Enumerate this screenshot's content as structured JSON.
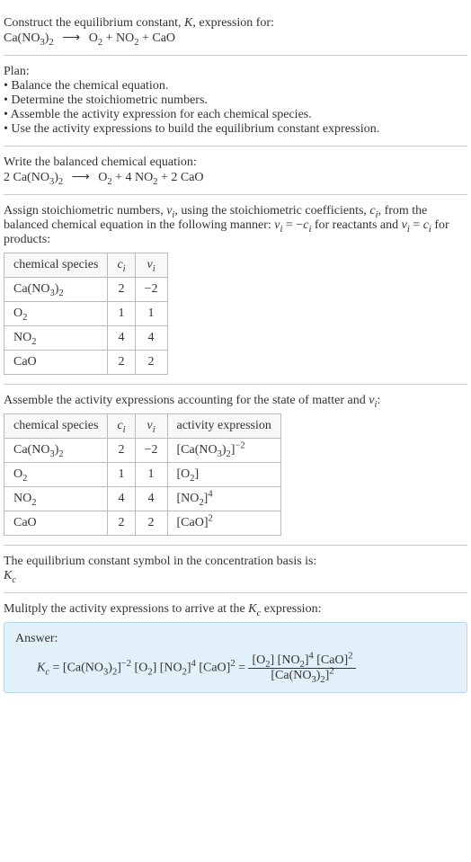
{
  "intro": {
    "line1_pre": "Construct the equilibrium constant, ",
    "line1_k": "K",
    "line1_post": ", expression for:"
  },
  "eq_unbalanced": {
    "r1": "Ca(NO",
    "r1s": "3",
    "r1_close": ")",
    "r1s2": "2",
    "p1": "O",
    "p1s": "2",
    "p2": "NO",
    "p2s": "2",
    "p3": "CaO"
  },
  "plan": {
    "header": "Plan:",
    "b1": "Balance the chemical equation.",
    "b2": "Determine the stoichiometric numbers.",
    "b3": "Assemble the activity expression for each chemical species.",
    "b4": "Use the activity expressions to build the equilibrium constant expression."
  },
  "balanced": {
    "header": "Write the balanced chemical equation:",
    "c1": "2 Ca(NO",
    "c1s": "3",
    "c1_close": ")",
    "c1s2": "2",
    "c2": "O",
    "c2s": "2",
    "c3": "4 NO",
    "c3s": "2",
    "c4": "2 CaO"
  },
  "stoich": {
    "text1": "Assign stoichiometric numbers, ",
    "nu": "ν",
    "nus": "i",
    "text2": ", using the stoichiometric coefficients, ",
    "c": "c",
    "cs": "i",
    "text3": ", from the balanced chemical equation in the following manner: ",
    "rel1_l": "ν",
    "rel1_ls": "i",
    "rel1_eq": " = −",
    "rel1_r": "c",
    "rel1_rs": "i",
    "text4": " for reactants and ",
    "rel2_l": "ν",
    "rel2_ls": "i",
    "rel2_eq": " = ",
    "rel2_r": "c",
    "rel2_rs": "i",
    "text5": " for products:"
  },
  "table1": {
    "h1": "chemical species",
    "h2c": "c",
    "h2s": "i",
    "h3c": "ν",
    "h3s": "i",
    "r1a": "Ca(NO",
    "r1as1": "3",
    "r1ac": ")",
    "r1as2": "2",
    "r1b": "2",
    "r1c": "−2",
    "r2a": "O",
    "r2as": "2",
    "r2b": "1",
    "r2c": "1",
    "r3a": "NO",
    "r3as": "2",
    "r3b": "4",
    "r3c": "4",
    "r4a": "CaO",
    "r4b": "2",
    "r4c": "2"
  },
  "activity": {
    "text1": "Assemble the activity expressions accounting for the state of matter and ",
    "nu": "ν",
    "nus": "i",
    "colon": ":"
  },
  "table2": {
    "h1": "chemical species",
    "h2c": "c",
    "h2s": "i",
    "h3c": "ν",
    "h3s": "i",
    "h4": "activity expression",
    "r1a": "Ca(NO",
    "r1as1": "3",
    "r1ac": ")",
    "r1as2": "2",
    "r1b": "2",
    "r1c": "−2",
    "r1d_pre": "[Ca(NO",
    "r1d_s1": "3",
    "r1d_mid": ")",
    "r1d_s2": "2",
    "r1d_close": "]",
    "r1d_exp": "−2",
    "r2a": "O",
    "r2as": "2",
    "r2b": "1",
    "r2c": "1",
    "r2d_pre": "[O",
    "r2d_s": "2",
    "r2d_close": "]",
    "r3a": "NO",
    "r3as": "2",
    "r3b": "4",
    "r3c": "4",
    "r3d_pre": "[NO",
    "r3d_s": "2",
    "r3d_close": "]",
    "r3d_exp": "4",
    "r4a": "CaO",
    "r4b": "2",
    "r4c": "2",
    "r4d_pre": "[CaO]",
    "r4d_exp": "2"
  },
  "ksym": {
    "line1": "The equilibrium constant symbol in the concentration basis is:",
    "k": "K",
    "ks": "c"
  },
  "mult": {
    "text1": "Mulitply the activity expressions to arrive at the ",
    "k": "K",
    "ks": "c",
    "text2": " expression:"
  },
  "answer": {
    "label": "Answer:",
    "k": "K",
    "ks": "c",
    "eq": " = ",
    "t1_pre": "[Ca(NO",
    "t1_s1": "3",
    "t1_mid": ")",
    "t1_s2": "2",
    "t1_close": "]",
    "t1_exp": "−2",
    "t2_pre": " [O",
    "t2_s": "2",
    "t2_close": "]",
    "t3_pre": " [NO",
    "t3_s": "2",
    "t3_close": "]",
    "t3_exp": "4",
    "t4_pre": " [CaO]",
    "t4_exp": "2",
    "eq2": " = ",
    "num1_pre": "[O",
    "num1_s": "2",
    "num1_close": "]",
    "num2_pre": " [NO",
    "num2_s": "2",
    "num2_close": "]",
    "num2_exp": "4",
    "num3_pre": " [CaO]",
    "num3_exp": "2",
    "den_pre": "[Ca(NO",
    "den_s1": "3",
    "den_mid": ")",
    "den_s2": "2",
    "den_close": "]",
    "den_exp": "2"
  }
}
